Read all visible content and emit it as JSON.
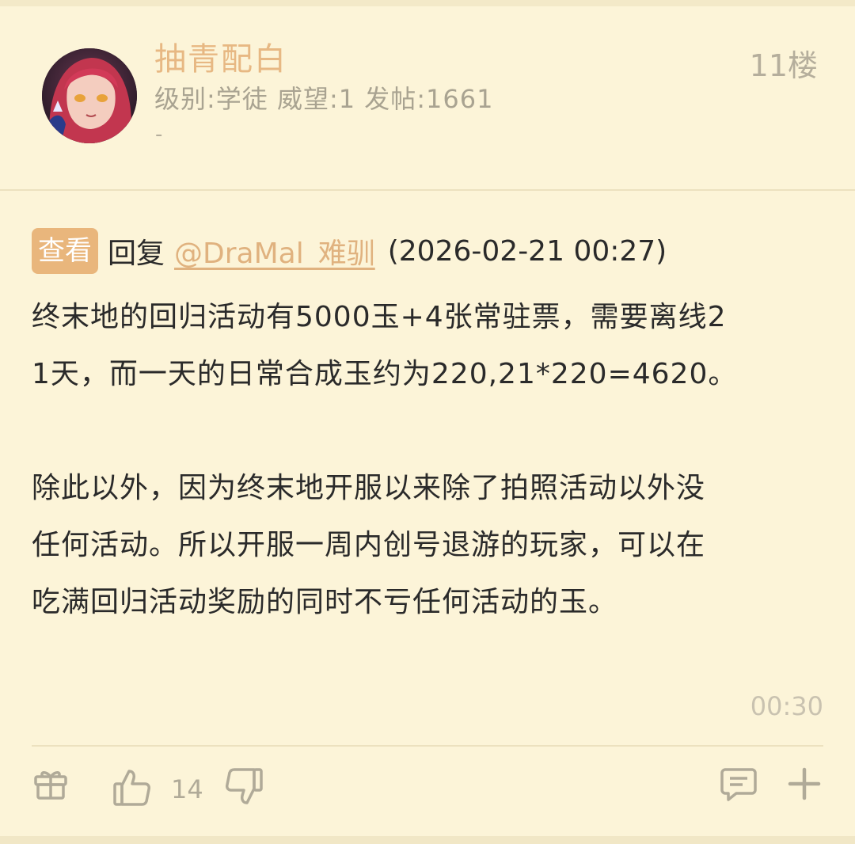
{
  "post": {
    "author_name": "抽青配白",
    "author_meta": "级别:学徒 威望:1 发帖:1661",
    "author_sub": "-",
    "floor": "11楼"
  },
  "reply": {
    "view_label": "查看",
    "reply_label": "回复",
    "mention": "@DraMal_难驯",
    "timestamp": "(2026-02-21 00:27)"
  },
  "content": {
    "line1": "终末地的回归活动有5000玉+4张常驻票，需要离线2",
    "line2": "1天，而一天的日常合成玉约为220,21*220=4620。",
    "line3": "除此以外，因为终末地开服以来除了拍照活动以外没",
    "line4": "任何活动。所以开服一周内创号退游的玩家，可以在",
    "line5": "吃满回归活动奖励的同时不亏任何活动的玉。"
  },
  "footer": {
    "time": "00:30",
    "like_count": "14",
    "icons": {
      "gift": "gift-icon",
      "like": "thumbs-up-icon",
      "dislike": "thumbs-down-icon",
      "comment": "comment-icon",
      "more": "plus-icon"
    }
  },
  "colors": {
    "background": "#fcf4d8",
    "accent": "#e9b67c",
    "author": "#e7b883",
    "muted": "#b0aa98"
  }
}
